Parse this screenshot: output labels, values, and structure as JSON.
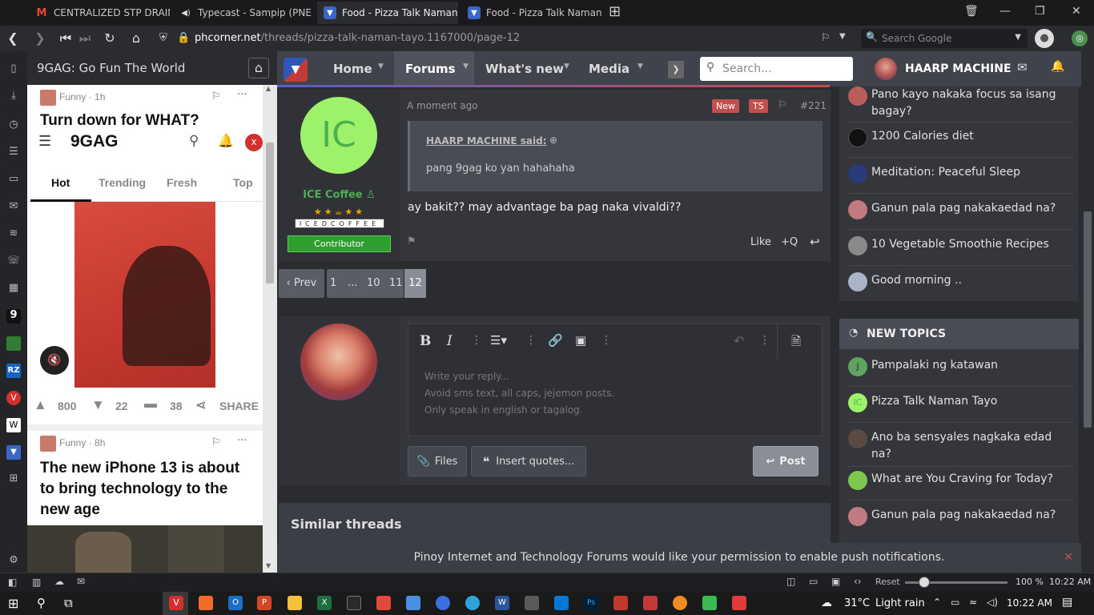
{
  "browser": {
    "tabs": [
      {
        "label": "CENTRALIZED STP DRAIN L"
      },
      {
        "label": "Typecast - Sampip (PNE Co"
      },
      {
        "label": "Food - Pizza Talk Naman Ta"
      },
      {
        "label": "Food - Pizza Talk Naman Ta"
      }
    ],
    "url_domain": "phcorner.net",
    "url_path": "/threads/pizza-talk-naman-tayo.1167000/page-12",
    "search_placeholder": "Search Google"
  },
  "panel": {
    "title": "9GAG: Go Fun The World",
    "post1_category": "Funny",
    "post1_time": "1h",
    "post1_title": "Turn down for WHAT?",
    "logo": "9GAG",
    "tabs": [
      "Hot",
      "Trending",
      "Fresh",
      "Top"
    ],
    "upvotes": "800",
    "downvotes": "22",
    "comments": "38",
    "share": "SHARE",
    "post2_category": "Funny",
    "post2_time": "8h",
    "post2_title": "The new iPhone 13 is about to bring technology to the new age",
    "avatar_letter": "x"
  },
  "nav": {
    "home": "Home",
    "forums": "Forums",
    "whats_new": "What's new",
    "media": "Media",
    "search_placeholder": "Search...",
    "username": "HAARP MACHINE"
  },
  "post": {
    "avatar_initials": "IC",
    "username": "ICE Coffee",
    "badge_word": "ICEDCOFFEE",
    "role": "Contributor",
    "time": "A moment ago",
    "tag_new": "New",
    "tag_ts": "TS",
    "number": "#221",
    "quote_author": "HAARP MACHINE said:",
    "quote_text": "pang 9gag ko yan hahahaha",
    "body": "ay bakit?? may advantage ba pag naka vivaldi??",
    "like": "Like",
    "quote_btn": "+Q"
  },
  "pagination": {
    "prev": "Prev",
    "pages": [
      "1",
      "...",
      "10",
      "11",
      "12"
    ]
  },
  "editor": {
    "placeholder_lines": [
      "Write your reply...",
      "Avoid sms text, all caps, jejemon posts.",
      "Only speak in english or tagalog."
    ],
    "files": "Files",
    "insert_quotes": "Insert quotes...",
    "post": "Post"
  },
  "similar_threads": "Similar threads",
  "notification_bar": "Pinoy Internet and Technology Forums would like your permission to enable push notifications.",
  "sidebar": {
    "latest": [
      "Pano kayo nakaka focus sa isang bagay?",
      "1200 Calories diet",
      "Meditation: Peaceful Sleep",
      "Ganun pala pag nakakaedad na?",
      "10 Vegetable Smoothie Recipes",
      "Good morning .."
    ],
    "new_topics_title": "NEW TOPICS",
    "new_topics": [
      {
        "initials": "J",
        "title": "Pampalaki ng katawan"
      },
      {
        "initials": "IC",
        "title": "Pizza Talk Naman Tayo"
      },
      {
        "initials": "",
        "title": "Ano ba sensyales nagkaka edad na?"
      },
      {
        "initials": "",
        "title": "What are You Craving for Today?"
      },
      {
        "initials": "",
        "title": "Ganun pala pag nakakaedad na?"
      }
    ]
  },
  "statusbar": {
    "reset": "Reset",
    "zoom": "100 %",
    "time": "10:22 AM",
    "zoom_level": 0.5
  },
  "taskbar": {
    "weather": "31°C",
    "weather_desc": "Light rain",
    "clock": "10:22 AM"
  },
  "colors": {
    "accent_green": "#4caf50",
    "avatar_green": "#9ef26a",
    "tag_red": "#c0504d"
  }
}
